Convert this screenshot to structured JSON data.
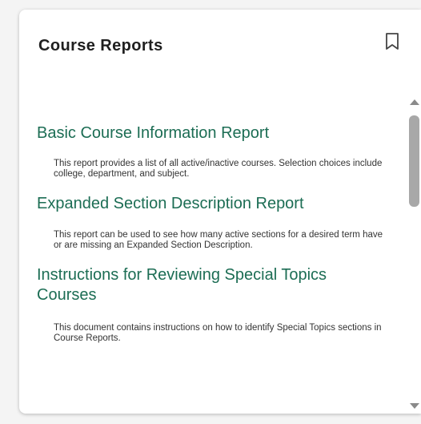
{
  "card": {
    "title": "Course Reports",
    "bookmark_icon": "bookmark-icon"
  },
  "reports": [
    {
      "title": "Basic Course Information Report",
      "description": "This report provides a list of all active/inactive courses. Selection choices include college, department, and subject."
    },
    {
      "title": "Expanded Section Description Report",
      "description": "This report can be used to see how many active sections for a desired term have or are missing an Expanded Section Description."
    },
    {
      "title": "Instructions for Reviewing Special Topics Courses",
      "description": "This document contains instructions on how to identify Special Topics sections in Course Reports."
    }
  ],
  "colors": {
    "link": "#1c6d54",
    "title": "#1f1f1f",
    "description": "#333333",
    "scrollbar": "#a8a8a8"
  }
}
